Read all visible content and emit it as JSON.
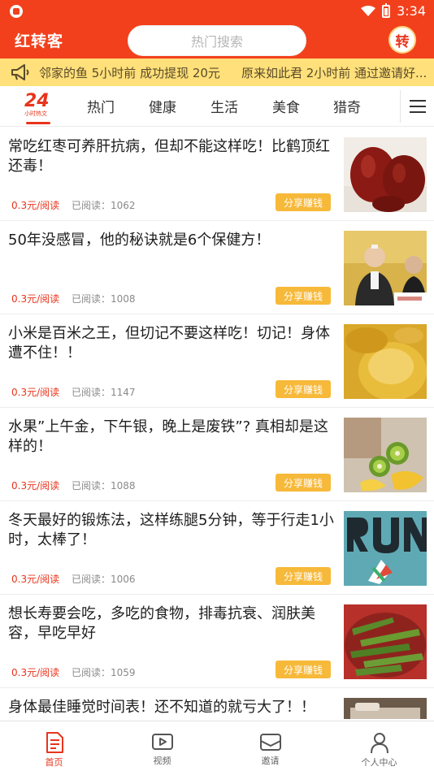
{
  "status_bar": {
    "time": "3:34"
  },
  "header": {
    "app_title": "红转客",
    "search_placeholder": "热门搜索",
    "sign_badge_text": "转"
  },
  "marquee": {
    "messages": [
      "邻家的鱼 5小时前 成功提现 20元",
      "原来如此君 2小时前 通过邀请好..."
    ]
  },
  "tabs": {
    "logo_text": "24",
    "logo_sub": "小时热文",
    "items": [
      "热门",
      "健康",
      "生活",
      "美食",
      "猎奇"
    ]
  },
  "articles": [
    {
      "title": "常吃红枣可养肝抗病，但却不能这样吃！比鹤顶红还毒！",
      "price": "0.3元/阅读",
      "reads_label": "已阅读：",
      "reads": "1062",
      "share": "分享赚钱",
      "thumb": "red-dates"
    },
    {
      "title": "50年没感冒，他的秘诀就是6个保健方！",
      "price": "0.3元/阅读",
      "reads_label": "已阅读：",
      "reads": "1008",
      "share": "分享赚钱",
      "thumb": "elderly-men"
    },
    {
      "title": "小米是百米之王，但切记不要这样吃！切记！身体遭不住！！",
      "price": "0.3元/阅读",
      "reads_label": "已阅读：",
      "reads": "1147",
      "share": "分享赚钱",
      "thumb": "millet"
    },
    {
      "title": "水果”上午金，下午银，晚上是废铁”? 真相却是这样的！",
      "price": "0.3元/阅读",
      "reads_label": "已阅读：",
      "reads": "1088",
      "share": "分享赚钱",
      "thumb": "kiwi-fruit"
    },
    {
      "title": "冬天最好的锻炼法，这样练腿5分钟，等于行走1小时，太棒了！",
      "price": "0.3元/阅读",
      "reads_label": "已阅读：",
      "reads": "1006",
      "share": "分享赚钱",
      "thumb": "run-poster"
    },
    {
      "title": "想长寿要会吃，多吃的食物，排毒抗衰、润肤美容，早吃早好",
      "price": "0.3元/阅读",
      "reads_label": "已阅读：",
      "reads": "1059",
      "share": "分享赚钱",
      "thumb": "okra"
    },
    {
      "title": "身体最佳睡觉时间表！还不知道的就亏大了！！",
      "thumb": "bed"
    }
  ],
  "bottom_nav": {
    "items": [
      {
        "label": "首页",
        "icon": "home-doc-icon"
      },
      {
        "label": "视频",
        "icon": "video-icon"
      },
      {
        "label": "邀请",
        "icon": "invite-envelope-icon"
      },
      {
        "label": "个人中心",
        "icon": "person-icon"
      }
    ]
  },
  "colors": {
    "primary_red": "#f2401c",
    "marquee_yellow": "#ffe07a",
    "share_orange": "#f7b93a",
    "price_red": "#e8341c"
  }
}
